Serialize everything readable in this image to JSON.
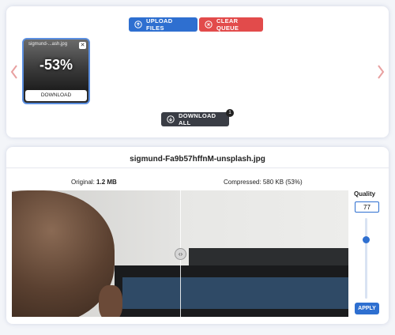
{
  "toolbar": {
    "upload_label": "UPLOAD FILES",
    "clear_label": "CLEAR QUEUE",
    "download_all_label": "DOWNLOAD ALL",
    "download_all_count": "1"
  },
  "queue": {
    "items": [
      {
        "name": "sigmund-...ash.jpg",
        "reduction": "-53%",
        "download_label": "DOWNLOAD"
      }
    ]
  },
  "viewer": {
    "filename": "sigmund-Fa9b57hffnM-unsplash.jpg",
    "original_label": "Original:",
    "original_size": "1.2 MB",
    "compressed_label": "Compressed:",
    "compressed_size": "580 KB (53%)",
    "quality_label": "Quality",
    "quality_value": "77",
    "apply_label": "APPLY",
    "quality_slider_fraction": 0.77
  },
  "colors": {
    "primary": "#2e6fd0",
    "danger": "#e24b4b",
    "dark": "#3a3d45",
    "arrow": "#e8a0a0"
  },
  "icons": {
    "upload": "upload-icon",
    "clear": "clear-icon",
    "download_all": "download-icon",
    "prev": "chevron-left-icon",
    "next": "chevron-right-icon",
    "close": "close-icon",
    "compare": "compare-handle-icon"
  }
}
